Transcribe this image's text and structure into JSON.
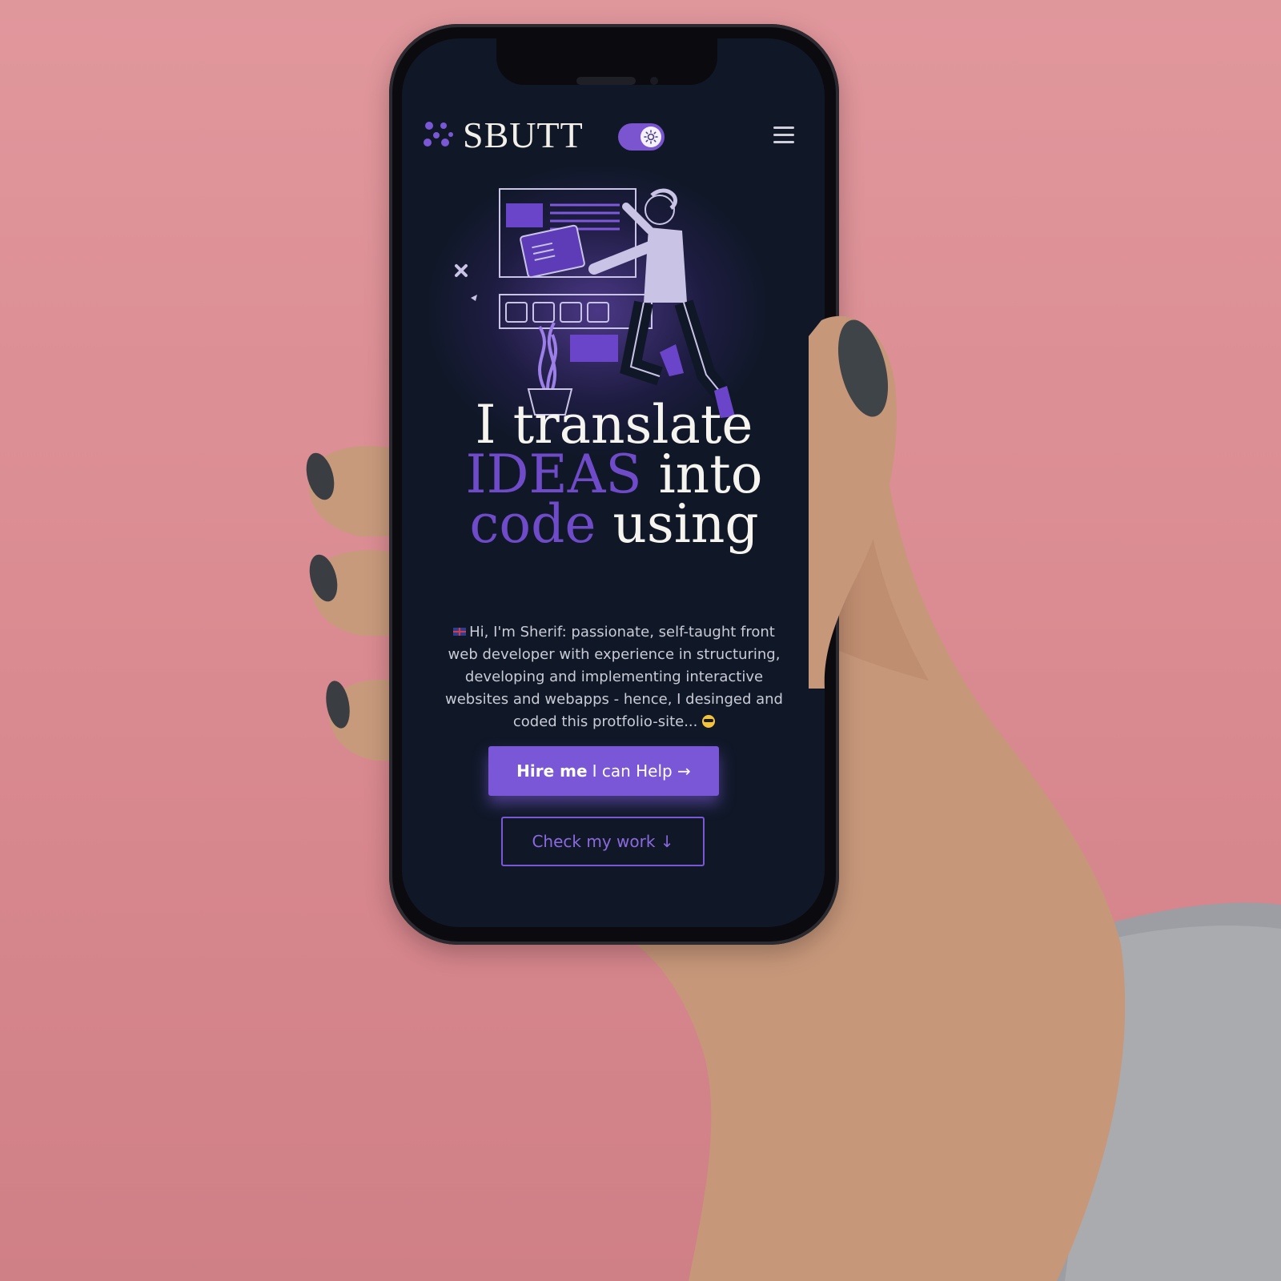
{
  "header": {
    "brand": "SBUTT"
  },
  "hero": {
    "headline_line1": "I translate",
    "headline_ideas": "IDEAS",
    "headline_into": " into",
    "headline_code": "code",
    "headline_using": " using",
    "bio": "Hi, I'm Sherif: passionate, self-taught front web developer with experience in structuring, developing and implementing interactive websites and webapps - hence, I desinged and coded this protfolio-site..."
  },
  "buttons": {
    "hire_bold": "Hire me",
    "hire_rest": "I can Help →",
    "check_work": "Check my work ↓"
  },
  "colors": {
    "background": "#d98a90",
    "screen": "#101828",
    "accent": "#7a57d6"
  },
  "icons": [
    "logo-icon",
    "theme-toggle-icon",
    "menu-icon",
    "flag-icon",
    "sunglasses-emoji-icon"
  ]
}
